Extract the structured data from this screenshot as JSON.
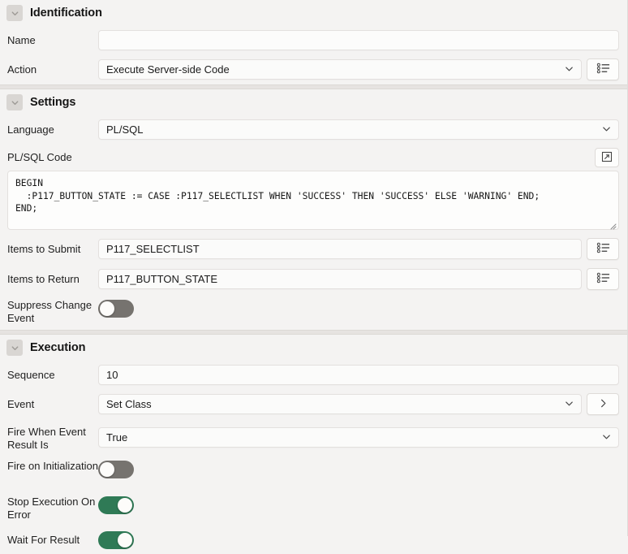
{
  "sections": [
    {
      "id": "identification",
      "title": "Identification",
      "collapse_icon": "chevron-down-icon"
    },
    {
      "id": "settings",
      "title": "Settings",
      "collapse_icon": "chevron-down-icon"
    },
    {
      "id": "execution",
      "title": "Execution",
      "collapse_icon": "chevron-down-icon"
    }
  ],
  "identification": {
    "name": {
      "label": "Name",
      "value": "",
      "placeholder": ""
    },
    "action": {
      "label": "Action",
      "value": "Execute Server-side Code",
      "dropdown_icon": "chevron-down-icon",
      "lov_button_icon": "list-icon"
    }
  },
  "settings": {
    "language": {
      "label": "Language",
      "value": "PL/SQL",
      "dropdown_icon": "chevron-down-icon"
    },
    "plsql_code": {
      "label": "PL/SQL Code",
      "expand_icon": "expand-popup-icon",
      "value": "BEGIN\n  :P117_BUTTON_STATE := CASE :P117_SELECTLIST WHEN 'SUCCESS' THEN 'SUCCESS' ELSE 'WARNING' END;\nEND;",
      "resize_icon": "resize-grip-icon"
    },
    "items_to_submit": {
      "label": "Items to Submit",
      "value": "P117_SELECTLIST",
      "lov_button_icon": "list-icon"
    },
    "items_to_return": {
      "label": "Items to Return",
      "value": "P117_BUTTON_STATE",
      "lov_button_icon": "list-icon"
    },
    "suppress_change_event": {
      "label": "Suppress Change Event",
      "state": "off"
    }
  },
  "execution": {
    "sequence": {
      "label": "Sequence",
      "value": "10"
    },
    "event": {
      "label": "Event",
      "value": "Set Class",
      "dropdown_icon": "chevron-down-icon",
      "goto_button_icon": "chevron-right-icon"
    },
    "fire_when_event_result_is": {
      "label": "Fire When Event Result Is",
      "value": "True",
      "dropdown_icon": "chevron-down-icon"
    },
    "fire_on_initialization": {
      "label": "Fire on Initialization",
      "state": "off"
    },
    "stop_execution_on_error": {
      "label": "Stop Execution On Error",
      "state": "on"
    },
    "wait_for_result": {
      "label": "Wait For Result",
      "state": "on"
    }
  },
  "colors": {
    "page_background": "#f4f3f2",
    "field_background": "#fbfbfa",
    "field_border": "#e3e0de",
    "toggle_on": "#2f7a56",
    "toggle_off": "#76736f",
    "section_separator": "#e6e3e1",
    "collapse_button": "#d9d6d3"
  }
}
